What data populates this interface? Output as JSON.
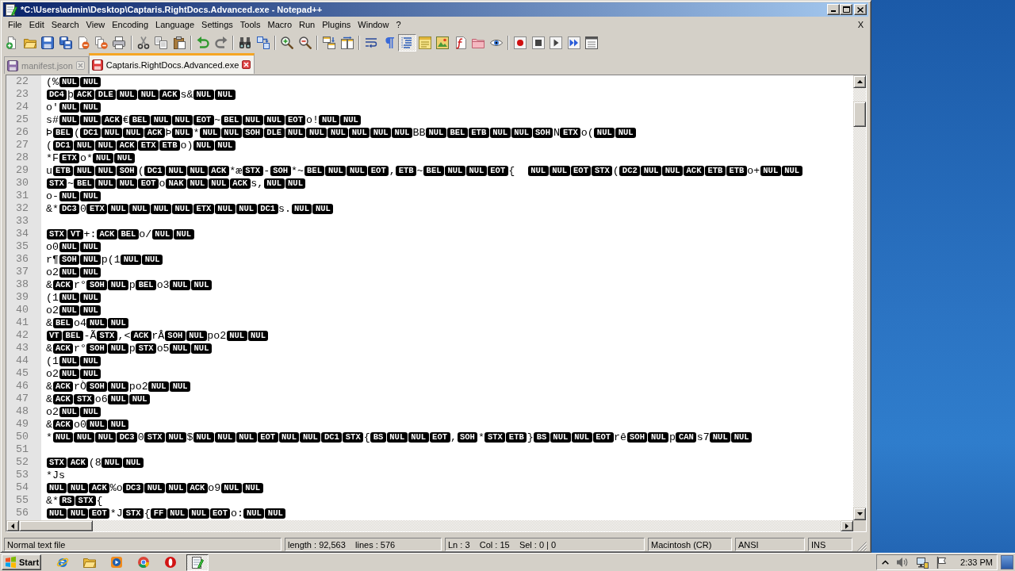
{
  "window": {
    "title": "*C:\\Users\\admin\\Desktop\\Captaris.RightDocs.Advanced.exe - Notepad++"
  },
  "menu": {
    "items": [
      "File",
      "Edit",
      "Search",
      "View",
      "Encoding",
      "Language",
      "Settings",
      "Tools",
      "Macro",
      "Run",
      "Plugins",
      "Window",
      "?"
    ],
    "close_document": "X"
  },
  "toolbar": [
    {
      "items": [
        {
          "kind": "new",
          "pressed": false
        },
        {
          "kind": "open",
          "pressed": false
        },
        {
          "kind": "save",
          "pressed": false
        },
        {
          "kind": "saveall",
          "pressed": false
        },
        {
          "kind": "close",
          "pressed": false
        },
        {
          "kind": "closeall",
          "pressed": false
        },
        {
          "kind": "print",
          "pressed": false
        }
      ]
    },
    {
      "items": [
        {
          "kind": "cut",
          "pressed": false
        },
        {
          "kind": "copy",
          "pressed": false
        },
        {
          "kind": "paste",
          "pressed": false
        }
      ]
    },
    {
      "items": [
        {
          "kind": "undo",
          "pressed": false
        },
        {
          "kind": "redo",
          "pressed": false
        }
      ]
    },
    {
      "items": [
        {
          "kind": "find",
          "pressed": false
        },
        {
          "kind": "replace",
          "pressed": false
        }
      ]
    },
    {
      "items": [
        {
          "kind": "zoomin",
          "pressed": false
        },
        {
          "kind": "zoomout",
          "pressed": false
        }
      ]
    },
    {
      "items": [
        {
          "kind": "syncv",
          "pressed": false
        },
        {
          "kind": "synch",
          "pressed": false
        }
      ]
    },
    {
      "items": [
        {
          "kind": "wrap",
          "pressed": false
        },
        {
          "kind": "allchars",
          "pressed": false
        },
        {
          "kind": "indent",
          "pressed": true
        },
        {
          "kind": "udl",
          "pressed": false
        },
        {
          "kind": "docmap",
          "pressed": false
        },
        {
          "kind": "funclist",
          "pressed": false
        },
        {
          "kind": "workspace",
          "pressed": false
        },
        {
          "kind": "monitor",
          "pressed": false
        }
      ]
    },
    {
      "items": [
        {
          "kind": "record",
          "pressed": false
        },
        {
          "kind": "stop",
          "pressed": false
        },
        {
          "kind": "play",
          "pressed": false
        },
        {
          "kind": "playmulti",
          "pressed": false
        },
        {
          "kind": "savemacro",
          "pressed": false
        }
      ]
    }
  ],
  "tabs": [
    {
      "label": "manifest.json",
      "selected": false,
      "modified": false
    },
    {
      "label": "Captaris.RightDocs.Advanced.exe",
      "selected": true,
      "modified": true
    }
  ],
  "editor": {
    "lines": [
      {
        "number": "22",
        "segments": [
          {
            "kind": "text",
            "text": "(%"
          },
          {
            "kind": "ctrl",
            "text": "NUL"
          },
          {
            "kind": "ctrl",
            "text": "NUL"
          }
        ]
      },
      {
        "number": "23",
        "segments": [
          {
            "kind": "ctrl",
            "text": "DC4"
          },
          {
            "kind": "text",
            "text": "þ"
          },
          {
            "kind": "ctrl",
            "text": "ACK"
          },
          {
            "kind": "ctrl",
            "text": "DLE"
          },
          {
            "kind": "ctrl",
            "text": "NUL"
          },
          {
            "kind": "ctrl",
            "text": "NUL"
          },
          {
            "kind": "ctrl",
            "text": "ACK"
          },
          {
            "kind": "text",
            "text": "s&"
          },
          {
            "kind": "ctrl",
            "text": "NUL"
          },
          {
            "kind": "ctrl",
            "text": "NUL"
          }
        ]
      },
      {
        "number": "24",
        "segments": [
          {
            "kind": "text",
            "text": "o'"
          },
          {
            "kind": "ctrl",
            "text": "NUL"
          },
          {
            "kind": "ctrl",
            "text": "NUL"
          }
        ]
      },
      {
        "number": "25",
        "segments": [
          {
            "kind": "text",
            "text": "s#"
          },
          {
            "kind": "ctrl",
            "text": "NUL"
          },
          {
            "kind": "ctrl",
            "text": "NUL"
          },
          {
            "kind": "ctrl",
            "text": "ACK"
          },
          {
            "kind": "text",
            "text": "€"
          },
          {
            "kind": "ctrl",
            "text": "BEL"
          },
          {
            "kind": "ctrl",
            "text": "NUL"
          },
          {
            "kind": "ctrl",
            "text": "NUL"
          },
          {
            "kind": "ctrl",
            "text": "EOT"
          },
          {
            "kind": "text",
            "text": "~"
          },
          {
            "kind": "ctrl",
            "text": "BEL"
          },
          {
            "kind": "ctrl",
            "text": "NUL"
          },
          {
            "kind": "ctrl",
            "text": "NUL"
          },
          {
            "kind": "ctrl",
            "text": "EOT"
          },
          {
            "kind": "text",
            "text": "o!"
          },
          {
            "kind": "ctrl",
            "text": "NUL"
          },
          {
            "kind": "ctrl",
            "text": "NUL"
          }
        ]
      },
      {
        "number": "26",
        "segments": [
          {
            "kind": "text",
            "text": "Þ"
          },
          {
            "kind": "ctrl",
            "text": "BEL"
          },
          {
            "kind": "text",
            "text": "("
          },
          {
            "kind": "ctrl",
            "text": "DC1"
          },
          {
            "kind": "ctrl",
            "text": "NUL"
          },
          {
            "kind": "ctrl",
            "text": "NUL"
          },
          {
            "kind": "ctrl",
            "text": "ACK"
          },
          {
            "kind": "text",
            "text": "Þ"
          },
          {
            "kind": "ctrl",
            "text": "NUL"
          },
          {
            "kind": "text",
            "text": "*"
          },
          {
            "kind": "ctrl",
            "text": "NUL"
          },
          {
            "kind": "ctrl",
            "text": "NUL"
          },
          {
            "kind": "ctrl",
            "text": "SOH"
          },
          {
            "kind": "ctrl",
            "text": "DLE"
          },
          {
            "kind": "ctrl",
            "text": "NUL"
          },
          {
            "kind": "ctrl",
            "text": "NUL"
          },
          {
            "kind": "ctrl",
            "text": "NUL"
          },
          {
            "kind": "ctrl",
            "text": "NUL"
          },
          {
            "kind": "ctrl",
            "text": "NUL"
          },
          {
            "kind": "ctrl",
            "text": "NUL"
          },
          {
            "kind": "text",
            "text": "BB"
          },
          {
            "kind": "ctrl",
            "text": "NUL"
          },
          {
            "kind": "ctrl",
            "text": "BEL"
          },
          {
            "kind": "ctrl",
            "text": "ETB"
          },
          {
            "kind": "ctrl",
            "text": "NUL"
          },
          {
            "kind": "ctrl",
            "text": "NUL"
          },
          {
            "kind": "ctrl",
            "text": "SOH"
          },
          {
            "kind": "text",
            "text": "N"
          },
          {
            "kind": "ctrl",
            "text": "ETX"
          },
          {
            "kind": "text",
            "text": "o("
          },
          {
            "kind": "ctrl",
            "text": "NUL"
          },
          {
            "kind": "ctrl",
            "text": "NUL"
          }
        ]
      },
      {
        "number": "27",
        "segments": [
          {
            "kind": "text",
            "text": "("
          },
          {
            "kind": "ctrl",
            "text": "DC1"
          },
          {
            "kind": "ctrl",
            "text": "NUL"
          },
          {
            "kind": "ctrl",
            "text": "NUL"
          },
          {
            "kind": "ctrl",
            "text": "ACK"
          },
          {
            "kind": "ctrl",
            "text": "ETX"
          },
          {
            "kind": "ctrl",
            "text": "ETB"
          },
          {
            "kind": "text",
            "text": "o)"
          },
          {
            "kind": "ctrl",
            "text": "NUL"
          },
          {
            "kind": "ctrl",
            "text": "NUL"
          }
        ]
      },
      {
        "number": "28",
        "segments": [
          {
            "kind": "text",
            "text": "*F"
          },
          {
            "kind": "ctrl",
            "text": "ETX"
          },
          {
            "kind": "text",
            "text": "o*"
          },
          {
            "kind": "ctrl",
            "text": "NUL"
          },
          {
            "kind": "ctrl",
            "text": "NUL"
          }
        ]
      },
      {
        "number": "29",
        "segments": [
          {
            "kind": "text",
            "text": "u"
          },
          {
            "kind": "ctrl",
            "text": "ETB"
          },
          {
            "kind": "ctrl",
            "text": "NUL"
          },
          {
            "kind": "ctrl",
            "text": "NUL"
          },
          {
            "kind": "ctrl",
            "text": "SOH"
          },
          {
            "kind": "text",
            "text": "("
          },
          {
            "kind": "ctrl",
            "text": "DC1"
          },
          {
            "kind": "ctrl",
            "text": "NUL"
          },
          {
            "kind": "ctrl",
            "text": "NUL"
          },
          {
            "kind": "ctrl",
            "text": "ACK"
          },
          {
            "kind": "text",
            "text": "*æ"
          },
          {
            "kind": "ctrl",
            "text": "STX"
          },
          {
            "kind": "text",
            "text": "-"
          },
          {
            "kind": "ctrl",
            "text": "SOH"
          },
          {
            "kind": "text",
            "text": "*~"
          },
          {
            "kind": "ctrl",
            "text": "BEL"
          },
          {
            "kind": "ctrl",
            "text": "NUL"
          },
          {
            "kind": "ctrl",
            "text": "NUL"
          },
          {
            "kind": "ctrl",
            "text": "EOT"
          },
          {
            "kind": "text",
            "text": ","
          },
          {
            "kind": "ctrl",
            "text": "ETB"
          },
          {
            "kind": "text",
            "text": "~"
          },
          {
            "kind": "ctrl",
            "text": "BEL"
          },
          {
            "kind": "ctrl",
            "text": "NUL"
          },
          {
            "kind": "ctrl",
            "text": "NUL"
          },
          {
            "kind": "ctrl",
            "text": "EOT"
          },
          {
            "kind": "text",
            "text": "{  "
          },
          {
            "kind": "ctrl",
            "text": "NUL"
          },
          {
            "kind": "ctrl",
            "text": "NUL"
          },
          {
            "kind": "ctrl",
            "text": "EOT"
          },
          {
            "kind": "ctrl",
            "text": "STX"
          },
          {
            "kind": "text",
            "text": "("
          },
          {
            "kind": "ctrl",
            "text": "DC2"
          },
          {
            "kind": "ctrl",
            "text": "NUL"
          },
          {
            "kind": "ctrl",
            "text": "NUL"
          },
          {
            "kind": "ctrl",
            "text": "ACK"
          },
          {
            "kind": "ctrl",
            "text": "ETB"
          },
          {
            "kind": "ctrl",
            "text": "ETB"
          },
          {
            "kind": "text",
            "text": "o+"
          },
          {
            "kind": "ctrl",
            "text": "NUL"
          },
          {
            "kind": "ctrl",
            "text": "NUL"
          }
        ]
      },
      {
        "number": "30",
        "segments": [
          {
            "kind": "ctrl",
            "text": "STX"
          },
          {
            "kind": "text",
            "text": "~"
          },
          {
            "kind": "ctrl",
            "text": "BEL"
          },
          {
            "kind": "ctrl",
            "text": "NUL"
          },
          {
            "kind": "ctrl",
            "text": "NUL"
          },
          {
            "kind": "ctrl",
            "text": "EOT"
          },
          {
            "kind": "text",
            "text": "o"
          },
          {
            "kind": "ctrl",
            "text": "NAK"
          },
          {
            "kind": "ctrl",
            "text": "NUL"
          },
          {
            "kind": "ctrl",
            "text": "NUL"
          },
          {
            "kind": "ctrl",
            "text": "ACK"
          },
          {
            "kind": "text",
            "text": "s,"
          },
          {
            "kind": "ctrl",
            "text": "NUL"
          },
          {
            "kind": "ctrl",
            "text": "NUL"
          }
        ]
      },
      {
        "number": "31",
        "segments": [
          {
            "kind": "text",
            "text": "o-"
          },
          {
            "kind": "ctrl",
            "text": "NUL"
          },
          {
            "kind": "ctrl",
            "text": "NUL"
          }
        ]
      },
      {
        "number": "32",
        "segments": [
          {
            "kind": "text",
            "text": "&*"
          },
          {
            "kind": "ctrl",
            "text": "DC3"
          },
          {
            "kind": "text",
            "text": "0"
          },
          {
            "kind": "ctrl",
            "text": "ETX"
          },
          {
            "kind": "ctrl",
            "text": "NUL"
          },
          {
            "kind": "ctrl",
            "text": "NUL"
          },
          {
            "kind": "ctrl",
            "text": "NUL"
          },
          {
            "kind": "ctrl",
            "text": "NUL"
          },
          {
            "kind": "ctrl",
            "text": "ETX"
          },
          {
            "kind": "ctrl",
            "text": "NUL"
          },
          {
            "kind": "ctrl",
            "text": "NUL"
          },
          {
            "kind": "ctrl",
            "text": "DC1"
          },
          {
            "kind": "text",
            "text": "s."
          },
          {
            "kind": "ctrl",
            "text": "NUL"
          },
          {
            "kind": "ctrl",
            "text": "NUL"
          }
        ]
      },
      {
        "number": "33"
      },
      {
        "number": "34",
        "segments": [
          {
            "kind": "ctrl",
            "text": "STX"
          },
          {
            "kind": "ctrl",
            "text": "VT"
          },
          {
            "kind": "text",
            "text": "+:"
          },
          {
            "kind": "ctrl",
            "text": "ACK"
          },
          {
            "kind": "ctrl",
            "text": "BEL"
          },
          {
            "kind": "text",
            "text": "o/"
          },
          {
            "kind": "ctrl",
            "text": "NUL"
          },
          {
            "kind": "ctrl",
            "text": "NUL"
          }
        ]
      },
      {
        "number": "35",
        "segments": [
          {
            "kind": "text",
            "text": "o0"
          },
          {
            "kind": "ctrl",
            "text": "NUL"
          },
          {
            "kind": "ctrl",
            "text": "NUL"
          }
        ]
      },
      {
        "number": "36",
        "segments": [
          {
            "kind": "text",
            "text": "r¶"
          },
          {
            "kind": "ctrl",
            "text": "SOH"
          },
          {
            "kind": "ctrl",
            "text": "NUL"
          },
          {
            "kind": "text",
            "text": "p(1"
          },
          {
            "kind": "ctrl",
            "text": "NUL"
          },
          {
            "kind": "ctrl",
            "text": "NUL"
          }
        ]
      },
      {
        "number": "37",
        "segments": [
          {
            "kind": "text",
            "text": "o2"
          },
          {
            "kind": "ctrl",
            "text": "NUL"
          },
          {
            "kind": "ctrl",
            "text": "NUL"
          }
        ]
      },
      {
        "number": "38",
        "segments": [
          {
            "kind": "text",
            "text": "&"
          },
          {
            "kind": "ctrl",
            "text": "ACK"
          },
          {
            "kind": "text",
            "text": "r°"
          },
          {
            "kind": "ctrl",
            "text": "SOH"
          },
          {
            "kind": "ctrl",
            "text": "NUL"
          },
          {
            "kind": "text",
            "text": "p"
          },
          {
            "kind": "ctrl",
            "text": "BEL"
          },
          {
            "kind": "text",
            "text": "o3"
          },
          {
            "kind": "ctrl",
            "text": "NUL"
          },
          {
            "kind": "ctrl",
            "text": "NUL"
          }
        ]
      },
      {
        "number": "39",
        "segments": [
          {
            "kind": "text",
            "text": "(1"
          },
          {
            "kind": "ctrl",
            "text": "NUL"
          },
          {
            "kind": "ctrl",
            "text": "NUL"
          }
        ]
      },
      {
        "number": "40",
        "segments": [
          {
            "kind": "text",
            "text": "o2"
          },
          {
            "kind": "ctrl",
            "text": "NUL"
          },
          {
            "kind": "ctrl",
            "text": "NUL"
          }
        ]
      },
      {
        "number": "41",
        "segments": [
          {
            "kind": "text",
            "text": "&"
          },
          {
            "kind": "ctrl",
            "text": "BEL"
          },
          {
            "kind": "text",
            "text": "o4"
          },
          {
            "kind": "ctrl",
            "text": "NUL"
          },
          {
            "kind": "ctrl",
            "text": "NUL"
          }
        ]
      },
      {
        "number": "42",
        "segments": [
          {
            "kind": "ctrl",
            "text": "VT"
          },
          {
            "kind": "ctrl",
            "text": "BEL"
          },
          {
            "kind": "text",
            "text": "-Ã"
          },
          {
            "kind": "ctrl",
            "text": "STX"
          },
          {
            "kind": "text",
            "text": ",<"
          },
          {
            "kind": "ctrl",
            "text": "ACK"
          },
          {
            "kind": "text",
            "text": "rÂ"
          },
          {
            "kind": "ctrl",
            "text": "SOH"
          },
          {
            "kind": "ctrl",
            "text": "NUL"
          },
          {
            "kind": "text",
            "text": "po2"
          },
          {
            "kind": "ctrl",
            "text": "NUL"
          },
          {
            "kind": "ctrl",
            "text": "NUL"
          }
        ]
      },
      {
        "number": "43",
        "segments": [
          {
            "kind": "text",
            "text": "&"
          },
          {
            "kind": "ctrl",
            "text": "ACK"
          },
          {
            "kind": "text",
            "text": "r°"
          },
          {
            "kind": "ctrl",
            "text": "SOH"
          },
          {
            "kind": "ctrl",
            "text": "NUL"
          },
          {
            "kind": "text",
            "text": "p"
          },
          {
            "kind": "ctrl",
            "text": "STX"
          },
          {
            "kind": "text",
            "text": "o5"
          },
          {
            "kind": "ctrl",
            "text": "NUL"
          },
          {
            "kind": "ctrl",
            "text": "NUL"
          }
        ]
      },
      {
        "number": "44",
        "segments": [
          {
            "kind": "text",
            "text": "(1"
          },
          {
            "kind": "ctrl",
            "text": "NUL"
          },
          {
            "kind": "ctrl",
            "text": "NUL"
          }
        ]
      },
      {
        "number": "45",
        "segments": [
          {
            "kind": "text",
            "text": "o2"
          },
          {
            "kind": "ctrl",
            "text": "NUL"
          },
          {
            "kind": "ctrl",
            "text": "NUL"
          }
        ]
      },
      {
        "number": "46",
        "segments": [
          {
            "kind": "text",
            "text": "&"
          },
          {
            "kind": "ctrl",
            "text": "ACK"
          },
          {
            "kind": "text",
            "text": "rÒ"
          },
          {
            "kind": "ctrl",
            "text": "SOH"
          },
          {
            "kind": "ctrl",
            "text": "NUL"
          },
          {
            "kind": "text",
            "text": "po2"
          },
          {
            "kind": "ctrl",
            "text": "NUL"
          },
          {
            "kind": "ctrl",
            "text": "NUL"
          }
        ]
      },
      {
        "number": "47",
        "segments": [
          {
            "kind": "text",
            "text": "&"
          },
          {
            "kind": "ctrl",
            "text": "ACK"
          },
          {
            "kind": "ctrl",
            "text": "STX"
          },
          {
            "kind": "text",
            "text": "o6"
          },
          {
            "kind": "ctrl",
            "text": "NUL"
          },
          {
            "kind": "ctrl",
            "text": "NUL"
          }
        ]
      },
      {
        "number": "48",
        "segments": [
          {
            "kind": "text",
            "text": "o2"
          },
          {
            "kind": "ctrl",
            "text": "NUL"
          },
          {
            "kind": "ctrl",
            "text": "NUL"
          }
        ]
      },
      {
        "number": "49",
        "segments": [
          {
            "kind": "text",
            "text": "&"
          },
          {
            "kind": "ctrl",
            "text": "ACK"
          },
          {
            "kind": "text",
            "text": "o0"
          },
          {
            "kind": "ctrl",
            "text": "NUL"
          },
          {
            "kind": "ctrl",
            "text": "NUL"
          }
        ]
      },
      {
        "number": "50",
        "segments": [
          {
            "kind": "text",
            "text": "*"
          },
          {
            "kind": "ctrl",
            "text": "NUL"
          },
          {
            "kind": "ctrl",
            "text": "NUL"
          },
          {
            "kind": "ctrl",
            "text": "NUL"
          },
          {
            "kind": "ctrl",
            "text": "DC3"
          },
          {
            "kind": "text",
            "text": "0"
          },
          {
            "kind": "ctrl",
            "text": "STX"
          },
          {
            "kind": "ctrl",
            "text": "NUL"
          },
          {
            "kind": "text",
            "text": "$"
          },
          {
            "kind": "ctrl",
            "text": "NUL"
          },
          {
            "kind": "ctrl",
            "text": "NUL"
          },
          {
            "kind": "ctrl",
            "text": "NUL"
          },
          {
            "kind": "ctrl",
            "text": "EOT"
          },
          {
            "kind": "ctrl",
            "text": "NUL"
          },
          {
            "kind": "ctrl",
            "text": "NUL"
          },
          {
            "kind": "ctrl",
            "text": "DC1"
          },
          {
            "kind": "ctrl",
            "text": "STX"
          },
          {
            "kind": "text",
            "text": "{"
          },
          {
            "kind": "ctrl",
            "text": "BS"
          },
          {
            "kind": "ctrl",
            "text": "NUL"
          },
          {
            "kind": "ctrl",
            "text": "NUL"
          },
          {
            "kind": "ctrl",
            "text": "EOT"
          },
          {
            "kind": "text",
            "text": ","
          },
          {
            "kind": "ctrl",
            "text": "SOH"
          },
          {
            "kind": "text",
            "text": "*"
          },
          {
            "kind": "ctrl",
            "text": "STX"
          },
          {
            "kind": "ctrl",
            "text": "ETB"
          },
          {
            "kind": "text",
            "text": "}"
          },
          {
            "kind": "ctrl",
            "text": "BS"
          },
          {
            "kind": "ctrl",
            "text": "NUL"
          },
          {
            "kind": "ctrl",
            "text": "NUL"
          },
          {
            "kind": "ctrl",
            "text": "EOT"
          },
          {
            "kind": "text",
            "text": "rê"
          },
          {
            "kind": "ctrl",
            "text": "SOH"
          },
          {
            "kind": "ctrl",
            "text": "NUL"
          },
          {
            "kind": "text",
            "text": "p"
          },
          {
            "kind": "ctrl",
            "text": "CAN"
          },
          {
            "kind": "text",
            "text": "s7"
          },
          {
            "kind": "ctrl",
            "text": "NUL"
          },
          {
            "kind": "ctrl",
            "text": "NUL"
          }
        ]
      },
      {
        "number": "51"
      },
      {
        "number": "52",
        "segments": [
          {
            "kind": "ctrl",
            "text": "STX"
          },
          {
            "kind": "ctrl",
            "text": "ACK"
          },
          {
            "kind": "text",
            "text": "(8"
          },
          {
            "kind": "ctrl",
            "text": "NUL"
          },
          {
            "kind": "ctrl",
            "text": "NUL"
          }
        ]
      },
      {
        "number": "53",
        "segments": [
          {
            "kind": "text",
            "text": "*Js"
          }
        ]
      },
      {
        "number": "54",
        "segments": [
          {
            "kind": "ctrl",
            "text": "NUL"
          },
          {
            "kind": "ctrl",
            "text": "NUL"
          },
          {
            "kind": "ctrl",
            "text": "ACK"
          },
          {
            "kind": "text",
            "text": "%o"
          },
          {
            "kind": "ctrl",
            "text": "DC3"
          },
          {
            "kind": "ctrl",
            "text": "NUL"
          },
          {
            "kind": "ctrl",
            "text": "NUL"
          },
          {
            "kind": "ctrl",
            "text": "ACK"
          },
          {
            "kind": "text",
            "text": "o9"
          },
          {
            "kind": "ctrl",
            "text": "NUL"
          },
          {
            "kind": "ctrl",
            "text": "NUL"
          }
        ]
      },
      {
        "number": "55",
        "segments": [
          {
            "kind": "text",
            "text": "&*"
          },
          {
            "kind": "ctrl",
            "text": "RS"
          },
          {
            "kind": "ctrl",
            "text": "STX"
          },
          {
            "kind": "text",
            "text": "{"
          }
        ]
      },
      {
        "number": "56",
        "segments": [
          {
            "kind": "ctrl",
            "text": "NUL"
          },
          {
            "kind": "ctrl",
            "text": "NUL"
          },
          {
            "kind": "ctrl",
            "text": "EOT"
          },
          {
            "kind": "text",
            "text": "*J"
          },
          {
            "kind": "ctrl",
            "text": "STX"
          },
          {
            "kind": "text",
            "text": "{"
          },
          {
            "kind": "ctrl",
            "text": "FF"
          },
          {
            "kind": "ctrl",
            "text": "NUL"
          },
          {
            "kind": "ctrl",
            "text": "NUL"
          },
          {
            "kind": "ctrl",
            "text": "EOT"
          },
          {
            "kind": "text",
            "text": "o:"
          },
          {
            "kind": "ctrl",
            "text": "NUL"
          },
          {
            "kind": "ctrl",
            "text": "NUL"
          }
        ]
      }
    ]
  },
  "status_bar": {
    "fields": [
      "Normal text file",
      "length : 92,563    lines : 576",
      "Ln : 3    Col : 15    Sel : 0 | 0",
      "Macintosh (CR)",
      "ANSI",
      "INS"
    ]
  },
  "taskbar": {
    "start_label": "Start",
    "apps": [
      {
        "kind": "ie",
        "selected": false
      },
      {
        "kind": "explorer",
        "selected": false
      },
      {
        "kind": "mediaplayer",
        "selected": false
      },
      {
        "kind": "chrome",
        "selected": false
      },
      {
        "kind": "opera",
        "selected": false
      },
      {
        "kind": "notepad",
        "selected": true
      }
    ],
    "clock": "2:33 PM"
  }
}
